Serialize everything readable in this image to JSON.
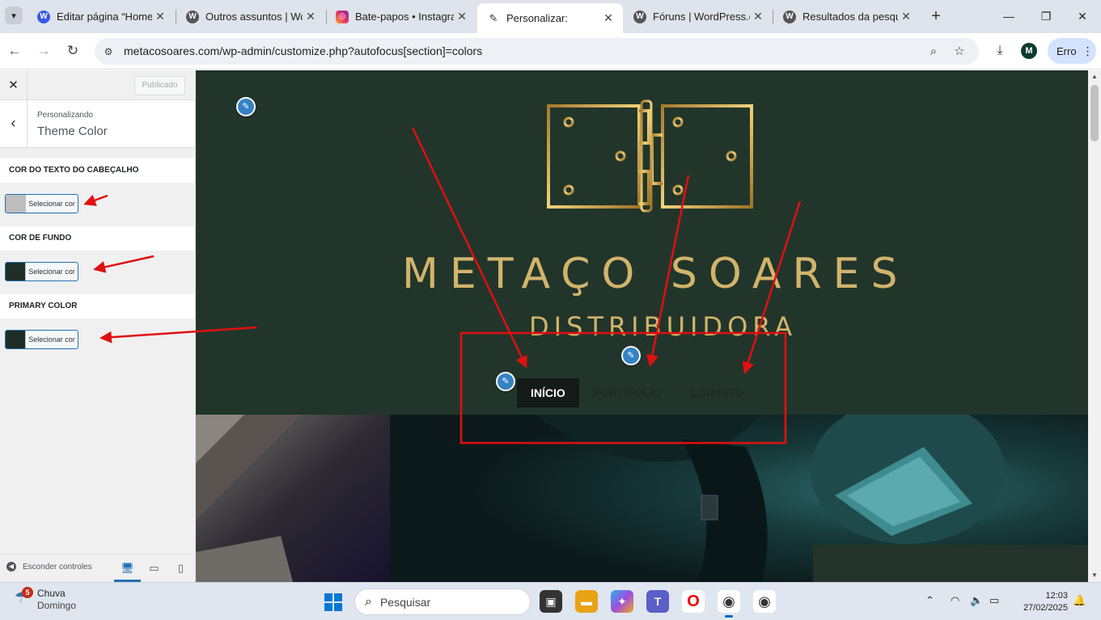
{
  "browser": {
    "tabs": [
      {
        "title": "Editar página “Home”",
        "favicon": "wordpress-icon",
        "active": false
      },
      {
        "title": "Outros assuntos | WordPress",
        "favicon": "wordpress-icon",
        "active": false
      },
      {
        "title": "Bate-papos • Instagram",
        "favicon": "instagram-icon",
        "active": false
      },
      {
        "title": "Personalizar:",
        "favicon": "wp-customize-icon",
        "active": true
      },
      {
        "title": "Fóruns | WordPress.org",
        "favicon": "wordpress-icon",
        "active": false
      },
      {
        "title": "Resultados da pesquisa",
        "favicon": "wordpress-icon",
        "active": false
      }
    ],
    "new_tab": "+",
    "url": "metacosoares.com/wp-admin/customize.php?autofocus[section]=colors",
    "profile_initial": "M",
    "error_label": "Erro"
  },
  "customizer": {
    "close": "✕",
    "publish_label": "Publicado",
    "breadcrumb": "Personalizando",
    "section_title": "Theme Color",
    "controls": [
      {
        "label": "Cor do texto do cabeçalho",
        "button": "Selecionar cor",
        "color": "#bdbdbd"
      },
      {
        "label": "Cor de fundo",
        "button": "Selecionar cor",
        "color": "#1d2e26"
      },
      {
        "label": "Primary color",
        "button": "Selecionar cor",
        "color": "#1d2e26"
      }
    ],
    "hide_controls": "Esconder controles"
  },
  "preview": {
    "brand_name": "METAÇO SOARES",
    "brand_sub": "DISTRIBUIDORA",
    "nav": [
      {
        "label": "INÍCIO",
        "current": true
      },
      {
        "label": "PORTIFÓLIO",
        "current": false
      },
      {
        "label": "CONTATO",
        "current": false
      }
    ],
    "colors": {
      "header_bg": "#22352b",
      "gold": "#d1b46b",
      "nav_current_bg": "#141a17",
      "annotation": "#e01010"
    }
  },
  "taskbar": {
    "weather_count": "5",
    "weather_title": "Chuva",
    "weather_sub": "Domingo",
    "search_placeholder": "Pesquisar",
    "time": "12:03",
    "date": "27/02/2025"
  }
}
